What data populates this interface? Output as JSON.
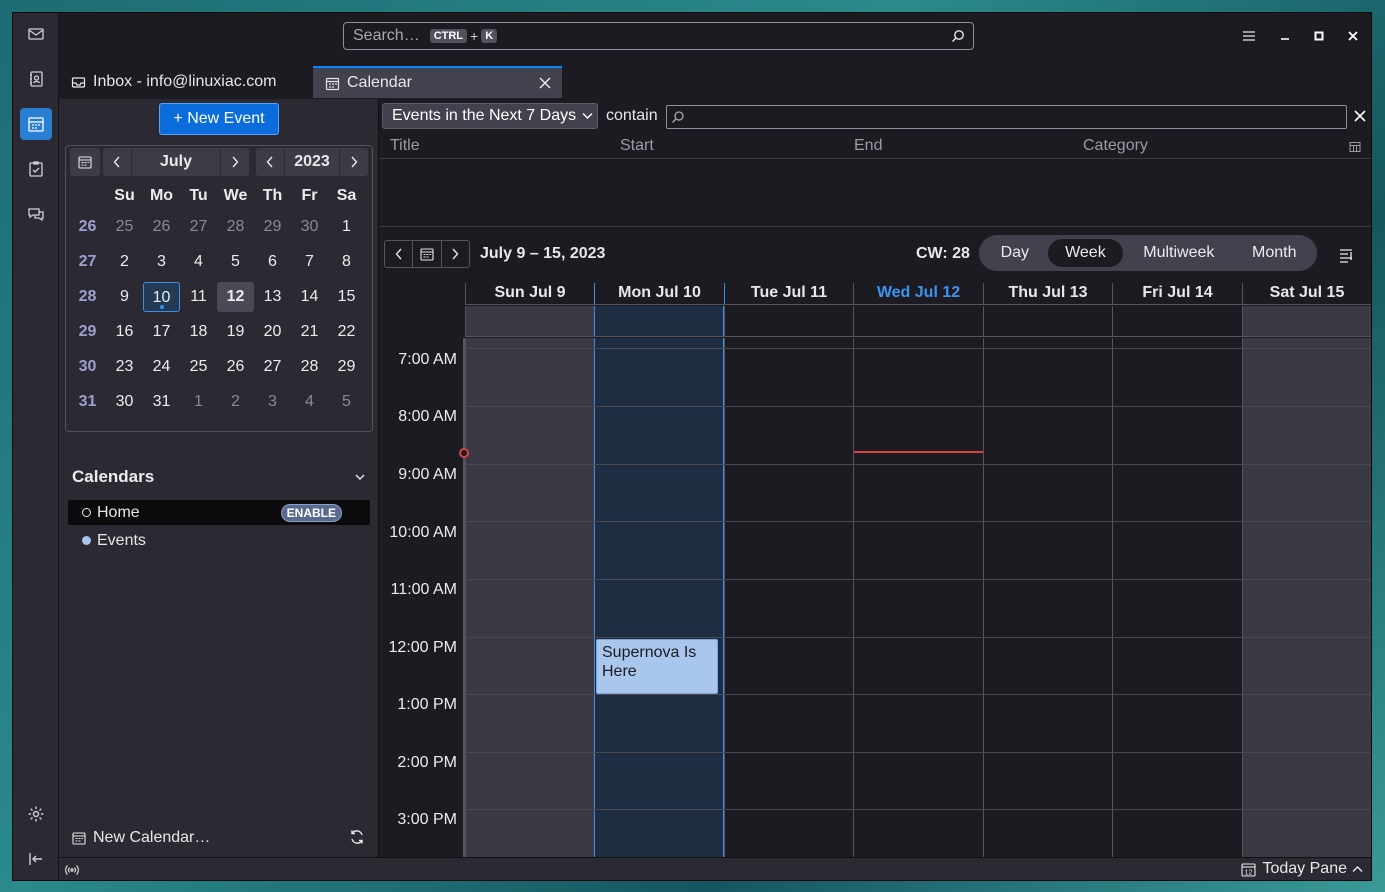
{
  "search": {
    "placeholder": "Search…",
    "kbd_ctrl": "CTRL",
    "kbd_plus": "+",
    "kbd_k": "K"
  },
  "tabs": [
    {
      "label": "Inbox - info@linuxiac.com"
    },
    {
      "label": "Calendar"
    }
  ],
  "left": {
    "new_event": "+  New Event",
    "month": "July",
    "year": "2023",
    "weekday_headers": [
      "Su",
      "Mo",
      "Tu",
      "We",
      "Th",
      "Fr",
      "Sa"
    ],
    "weeks": [
      {
        "wk": "26",
        "days": [
          "25",
          "26",
          "27",
          "28",
          "29",
          "30",
          "1"
        ]
      },
      {
        "wk": "27",
        "days": [
          "2",
          "3",
          "4",
          "5",
          "6",
          "7",
          "8"
        ]
      },
      {
        "wk": "28",
        "days": [
          "9",
          "10",
          "11",
          "12",
          "13",
          "14",
          "15"
        ]
      },
      {
        "wk": "29",
        "days": [
          "16",
          "17",
          "18",
          "19",
          "20",
          "21",
          "22"
        ]
      },
      {
        "wk": "30",
        "days": [
          "23",
          "24",
          "25",
          "26",
          "27",
          "28",
          "29"
        ]
      },
      {
        "wk": "31",
        "days": [
          "30",
          "31",
          "1",
          "2",
          "3",
          "4",
          "5"
        ]
      }
    ],
    "calendars_title": "Calendars",
    "calendars": [
      {
        "name": "Home",
        "badge": "ENABLE",
        "color": "#1c1b22"
      },
      {
        "name": "Events",
        "badge": "",
        "color": "#a9c6ec"
      }
    ],
    "new_calendar": "New Calendar…"
  },
  "unifinder": {
    "filter": "Events in the Next 7 Days",
    "contain": "contain",
    "columns": [
      "Title",
      "Start",
      "End",
      "Category"
    ]
  },
  "view": {
    "range": "July 9 – 15, 2023",
    "cw": "CW: 28",
    "tabs": [
      "Day",
      "Week",
      "Multiweek",
      "Month"
    ],
    "active_tab": "Week"
  },
  "week": {
    "days": [
      "Sun Jul 9",
      "Mon Jul 10",
      "Tue Jul 11",
      "Wed Jul 12",
      "Thu Jul 13",
      "Fri Jul 14",
      "Sat Jul 15"
    ],
    "today": "Wed Jul 12",
    "hours": [
      "7:00 AM",
      "8:00 AM",
      "9:00 AM",
      "10:00 AM",
      "11:00 AM",
      "12:00 PM",
      "1:00 PM",
      "2:00 PM",
      "3:00 PM"
    ],
    "events": [
      {
        "title": "Supernova Is Here",
        "day": "Mon Jul 10",
        "start": "12:00 PM",
        "end": "1:00 PM"
      }
    ]
  },
  "status": {
    "today_pane": "Today Pane"
  },
  "colors": {
    "accent": "#0a84ff",
    "event": "#a9c6ec",
    "now_line": "#d64545"
  }
}
